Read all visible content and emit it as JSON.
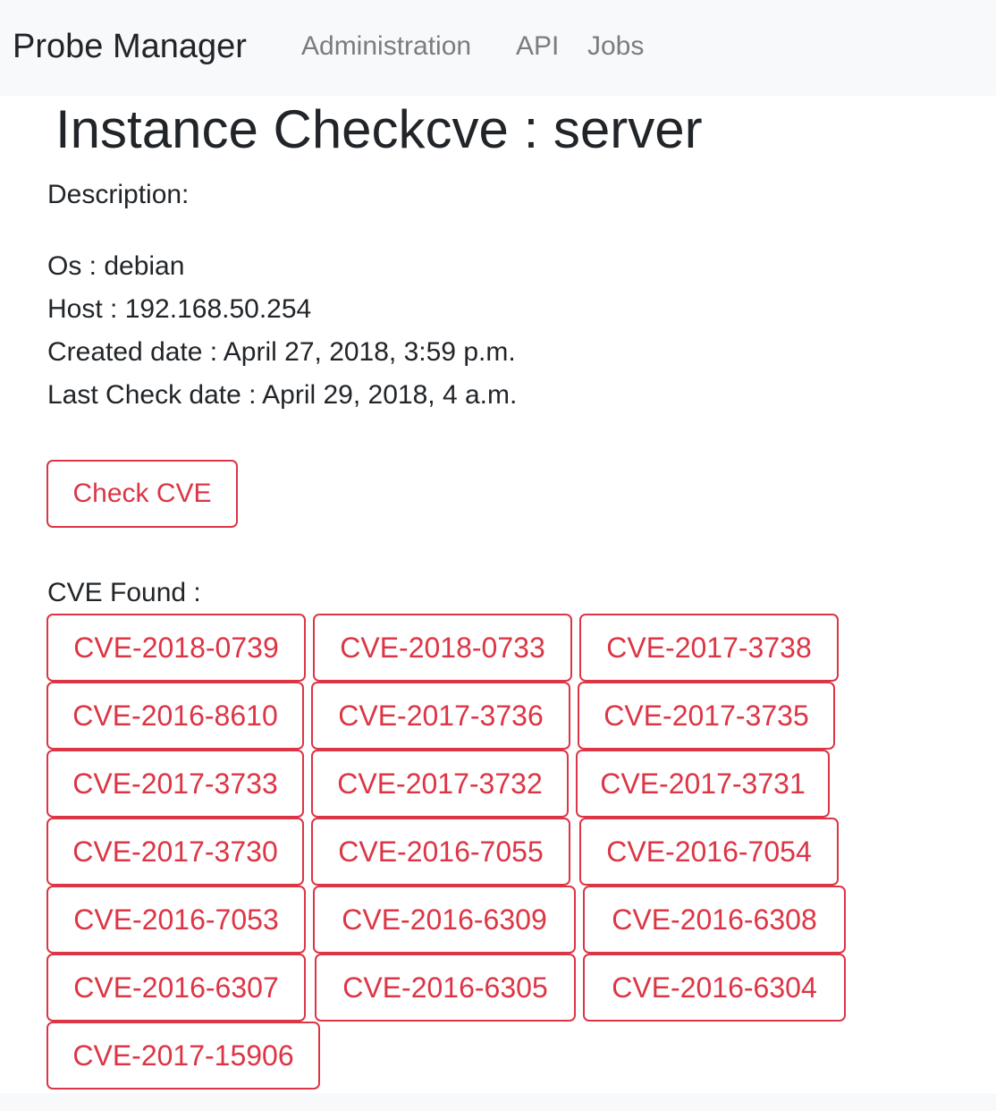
{
  "navbar": {
    "brand": "Probe Manager",
    "links": [
      "Administration",
      "API",
      "Jobs"
    ]
  },
  "page": {
    "title": "Instance Checkcve : server",
    "description_label": "Description:",
    "os_line": "Os : debian",
    "host_line": "Host : 192.168.50.254",
    "created_line": "Created date : April 27, 2018, 3:59 p.m.",
    "last_check_line": "Last Check date : April 29, 2018, 4 a.m.",
    "check_button": "Check CVE",
    "cve_found_label": "CVE Found :"
  },
  "cves": [
    "CVE-2018-0739",
    "CVE-2018-0733",
    "CVE-2017-3738",
    "CVE-2016-8610",
    "CVE-2017-3736",
    "CVE-2017-3735",
    "CVE-2017-3733",
    "CVE-2017-3732",
    "CVE-2017-3731",
    "CVE-2017-3730",
    "CVE-2016-7055",
    "CVE-2016-7054",
    "CVE-2016-7053",
    "CVE-2016-6309",
    "CVE-2016-6308",
    "CVE-2016-6307",
    "CVE-2016-6305",
    "CVE-2016-6304",
    "CVE-2017-15906"
  ],
  "colors": {
    "danger": "#dc3545",
    "navbar_bg": "#f8f9fa"
  }
}
